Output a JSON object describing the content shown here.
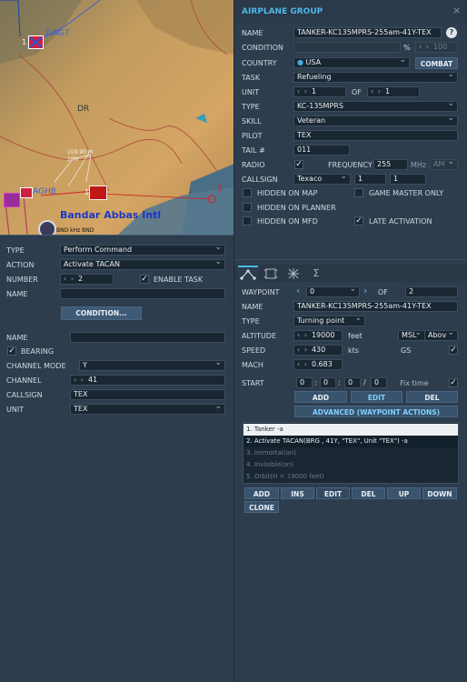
{
  "map": {
    "label_1": "1",
    "marker_1": "7:AG7",
    "label_dr": "DR",
    "freq_1": "109.90 M",
    "freq_2": "20N",
    "label_2": "1",
    "marker_2": "AGH8",
    "label_3": "3",
    "airport": "Bandar Abbas Intl",
    "beacon": "BND kHz BND"
  },
  "left": {
    "type_label": "TYPE",
    "type_value": "Perform Command",
    "action_label": "ACTION",
    "action_value": "Activate TACAN",
    "number_label": "NUMBER",
    "number_value": "2",
    "enable_task_label": "ENABLE TASK",
    "name_label": "NAME",
    "name_value": "",
    "condition_button": "CONDITION...",
    "name2_label": "NAME",
    "name2_value": "",
    "bearing_label": "BEARING",
    "channel_mode_label": "CHANNEL MODE",
    "channel_mode_value": "Y",
    "channel_label": "CHANNEL",
    "channel_value": "41",
    "callsign_label": "CALLSIGN",
    "callsign_value": "TEX",
    "unit_label": "UNIT",
    "unit_value": "TEX"
  },
  "group": {
    "title": "AIRPLANE GROUP",
    "close": "×",
    "name_label": "NAME",
    "name_value": "TANKER-KC135MPRS-255am-41Y-TEX",
    "help": "?",
    "condition_label": "CONDITION",
    "percent": "%",
    "percent_value": "100",
    "country_label": "COUNTRY",
    "country_value": "USA",
    "combat_button": "COMBAT",
    "task_label": "TASK",
    "task_value": "Refueling",
    "unit_label": "UNIT",
    "unit_value": "1",
    "of_label": "OF",
    "unit_of_value": "1",
    "type_label": "TYPE",
    "type_value": "KC-135MPRS",
    "skill_label": "SKILL",
    "skill_value": "Veteran",
    "pilot_label": "PILOT",
    "pilot_value": "TEX",
    "tail_label": "TAIL #",
    "tail_value": "011",
    "radio_label": "RADIO",
    "frequency_label": "FREQUENCY",
    "frequency_value": "255",
    "mhz": "MHz",
    "am_value": "AM",
    "callsign_label": "CALLSIGN",
    "callsign_value": "Texaco",
    "callsign_n1": "1",
    "callsign_n2": "1",
    "hidden_map": "HIDDEN ON MAP",
    "game_master": "GAME MASTER ONLY",
    "hidden_planner": "HIDDEN ON PLANNER",
    "hidden_mfd": "HIDDEN ON MFD",
    "late_activation": "LATE ACTIVATION"
  },
  "tabs": [
    "tab-route",
    "tab-triggered",
    "tab-payload",
    "tab-summary"
  ],
  "waypoint": {
    "label": "WAYPOINT",
    "value": "0",
    "of_label": "OF",
    "of_value": "2",
    "name_label": "NAME",
    "name_value": "TANKER-KC135MPRS-255am-41Y-TEX",
    "type_label": "TYPE",
    "type_value": "Turning point",
    "altitude_label": "ALTITUDE",
    "altitude_value": "19000",
    "feet": "feet",
    "msl_value": "MSL",
    "above_value": "Abov",
    "speed_label": "SPEED",
    "speed_value": "430",
    "kts": "kts",
    "gs": "GS",
    "mach_label": "MACH",
    "mach_value": "0.683",
    "start_label": "START",
    "t0": "0",
    "t1": "0",
    "t2": "0",
    "t3": "0",
    "fixtime": "Fix time",
    "add": "ADD",
    "edit": "EDIT",
    "del": "DEL",
    "advanced": "ADVANCED (WAYPOINT ACTIONS)"
  },
  "actions": [
    "1. Tanker -a",
    "2. Activate TACAN(BRG , 41Y, \"TEX\", Unit \"TEX\")  -a",
    "3. Immortal(on)",
    "4. Invisible(on)",
    "5. Orbit(H = 19000 feet)"
  ],
  "action_buttons": {
    "add": "ADD",
    "ins": "INS",
    "edit": "EDIT",
    "del": "DEL",
    "up": "UP",
    "down": "DOWN",
    "clone": "CLONE"
  }
}
